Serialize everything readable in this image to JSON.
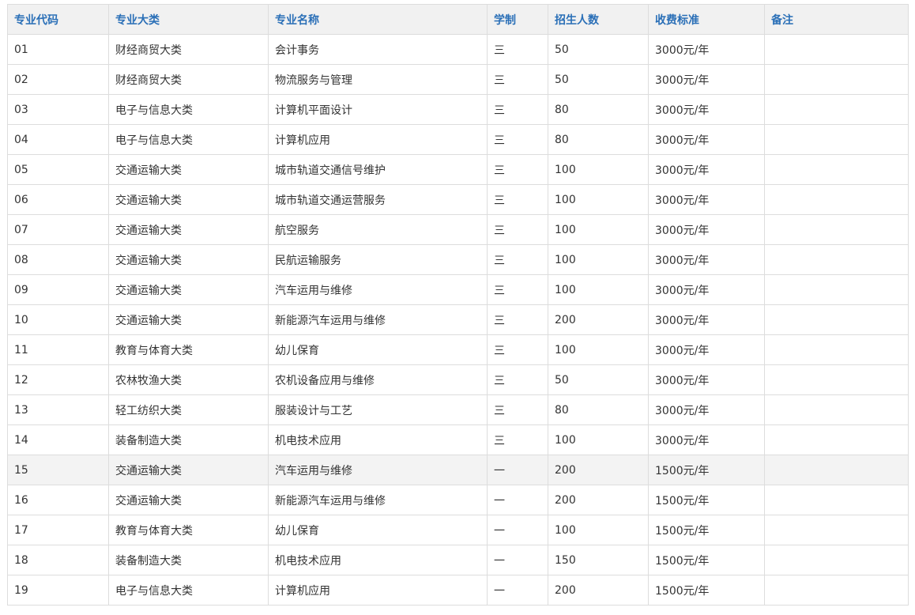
{
  "table": {
    "headers": [
      "专业代码",
      "专业大类",
      "专业名称",
      "学制",
      "招生人数",
      "收费标准",
      "备注"
    ],
    "rows": [
      [
        "01",
        "财经商贸大类",
        "会计事务",
        "三",
        "50",
        "3000元/年",
        ""
      ],
      [
        "02",
        "财经商贸大类",
        "物流服务与管理",
        "三",
        "50",
        "3000元/年",
        ""
      ],
      [
        "03",
        "电子与信息大类",
        "计算机平面设计",
        "三",
        "80",
        "3000元/年",
        ""
      ],
      [
        "04",
        "电子与信息大类",
        "计算机应用",
        "三",
        "80",
        "3000元/年",
        ""
      ],
      [
        "05",
        "交通运输大类",
        "城市轨道交通信号维护",
        "三",
        "100",
        "3000元/年",
        ""
      ],
      [
        "06",
        "交通运输大类",
        "城市轨道交通运营服务",
        "三",
        "100",
        "3000元/年",
        ""
      ],
      [
        "07",
        "交通运输大类",
        "航空服务",
        "三",
        "100",
        "3000元/年",
        ""
      ],
      [
        "08",
        "交通运输大类",
        "民航运输服务",
        "三",
        "100",
        "3000元/年",
        ""
      ],
      [
        "09",
        "交通运输大类",
        "汽车运用与维修",
        "三",
        "100",
        "3000元/年",
        ""
      ],
      [
        "10",
        "交通运输大类",
        "新能源汽车运用与维修",
        "三",
        "200",
        "3000元/年",
        ""
      ],
      [
        "11",
        "教育与体育大类",
        "幼儿保育",
        "三",
        "100",
        "3000元/年",
        ""
      ],
      [
        "12",
        "农林牧渔大类",
        "农机设备应用与维修",
        "三",
        "50",
        "3000元/年",
        ""
      ],
      [
        "13",
        "轻工纺织大类",
        "服装设计与工艺",
        "三",
        "80",
        "3000元/年",
        ""
      ],
      [
        "14",
        "装备制造大类",
        "机电技术应用",
        "三",
        "100",
        "3000元/年",
        ""
      ],
      [
        "15",
        "交通运输大类",
        "汽车运用与维修",
        "一",
        "200",
        "1500元/年",
        ""
      ],
      [
        "16",
        "交通运输大类",
        "新能源汽车运用与维修",
        "一",
        "200",
        "1500元/年",
        ""
      ],
      [
        "17",
        "教育与体育大类",
        "幼儿保育",
        "一",
        "100",
        "1500元/年",
        ""
      ],
      [
        "18",
        "装备制造大类",
        "机电技术应用",
        "一",
        "150",
        "1500元/年",
        ""
      ],
      [
        "19",
        "电子与信息大类",
        "计算机应用",
        "一",
        "200",
        "1500元/年",
        ""
      ]
    ],
    "highlighted_row": 14
  },
  "colors": {
    "header_text": "#2a6fb7",
    "header_bg": "#f1f1f1",
    "border": "#dddddd",
    "highlight_bg": "#f3f3f3"
  }
}
